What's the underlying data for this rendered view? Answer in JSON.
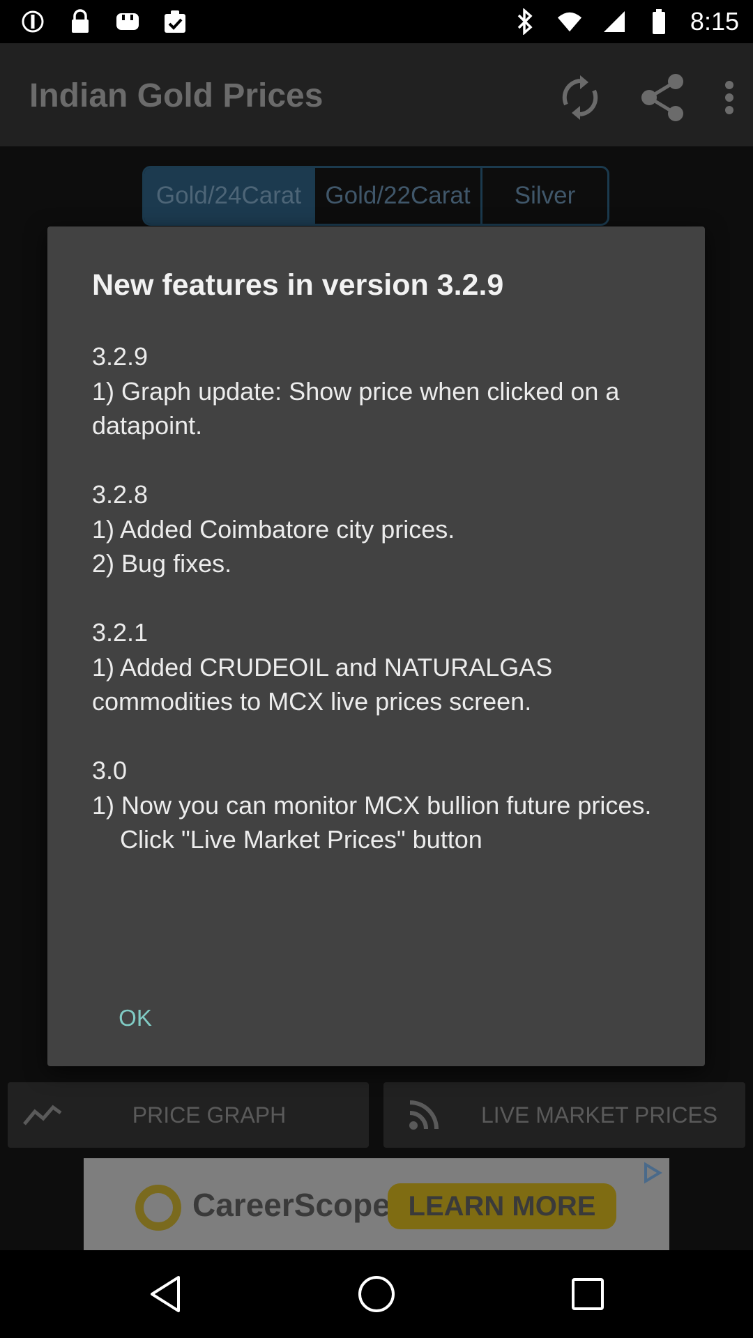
{
  "status_bar": {
    "time": "8:15",
    "left_icons": [
      "do-not-disturb-icon",
      "lock-icon",
      "app-notification-icon",
      "task-done-icon"
    ],
    "right_icons": [
      "bluetooth-icon",
      "wifi-icon",
      "signal-icon",
      "battery-icon"
    ]
  },
  "app_bar": {
    "title": "Indian Gold Prices",
    "actions": [
      "refresh-icon",
      "share-icon",
      "overflow-menu-icon"
    ]
  },
  "tabs": [
    {
      "label": "Gold/24Carat",
      "selected": true
    },
    {
      "label": "Gold/22Carat",
      "selected": false
    },
    {
      "label": "Silver",
      "selected": false
    }
  ],
  "dialog": {
    "title": "New features in version 3.2.9",
    "body": "3.2.9\n1) Graph update: Show price when clicked on a datapoint.\n\n3.2.8\n1) Added Coimbatore city prices.\n2) Bug fixes.\n\n3.2.1\n1) Added CRUDEOIL and NATURALGAS commodities to MCX live prices screen.\n\n3.0\n1) Now you can monitor MCX bullion future prices.\n    Click \"Live Market Prices\" button",
    "ok_label": "OK"
  },
  "bottom_buttons": {
    "price_graph": "PRICE GRAPH",
    "live_market_prices": "LIVE MARKET PRICES"
  },
  "ad": {
    "brand": "CareerScope",
    "cta": "LEARN MORE"
  },
  "nav_bar": [
    "back-icon",
    "home-icon",
    "recents-icon"
  ],
  "colors": {
    "dialog_bg": "#424242",
    "accent_teal": "#80cbc4",
    "appbar_bg": "#212121",
    "tab_active_bg": "#1c3a4f"
  }
}
